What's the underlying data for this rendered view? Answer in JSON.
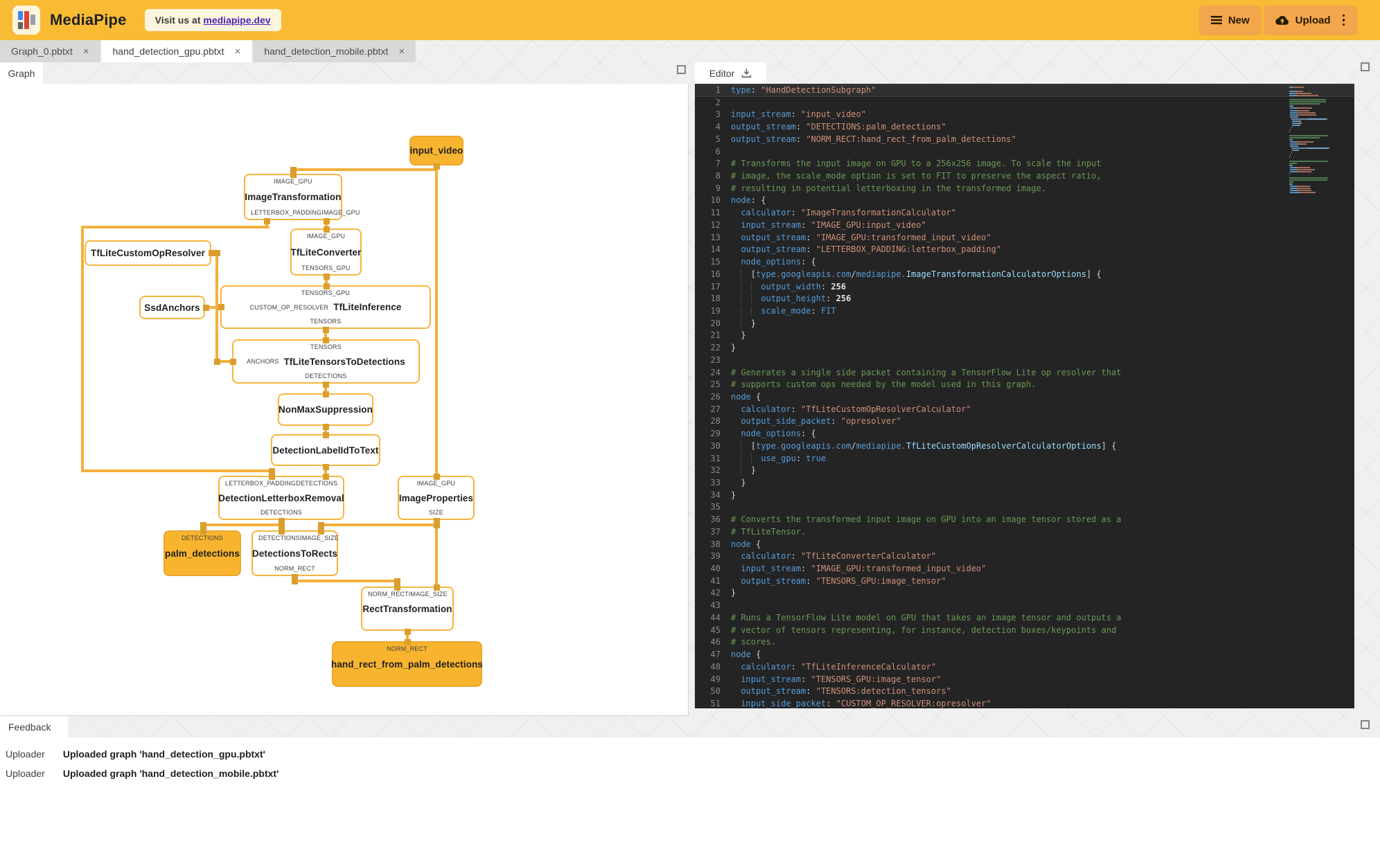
{
  "header": {
    "app_title": "MediaPipe",
    "visit_prefix": "Visit us at ",
    "visit_link": "mediapipe.dev",
    "new_label": "New",
    "upload_label": "Upload"
  },
  "tabs": [
    {
      "label": "Graph_0.pbtxt",
      "active": false
    },
    {
      "label": "hand_detection_gpu.pbtxt",
      "active": true
    },
    {
      "label": "hand_detection_mobile.pbtxt",
      "active": false
    }
  ],
  "graph_panel": {
    "tab_label": "Graph",
    "nodes": [
      {
        "id": "input_video",
        "label": "input_video",
        "kind": "stream",
        "ports": {}
      },
      {
        "id": "ImageTransformation",
        "label": "ImageTransformation",
        "kind": "calc",
        "ports": {
          "top": [
            "IMAGE_GPU"
          ],
          "bottom": [
            "LETTERBOX_PADDING",
            "IMAGE_GPU"
          ]
        }
      },
      {
        "id": "TfLiteCustomOpResolver",
        "label": "TfLiteCustomOpResolver",
        "kind": "calc",
        "ports": {}
      },
      {
        "id": "TfLiteConverter",
        "label": "TfLiteConverter",
        "kind": "calc",
        "ports": {
          "top": [
            "IMAGE_GPU"
          ],
          "bottom": [
            "TENSORS_GPU"
          ]
        }
      },
      {
        "id": "SsdAnchors",
        "label": "SsdAnchors",
        "kind": "calc",
        "ports": {}
      },
      {
        "id": "TfLiteInference",
        "label": "TfLiteInference",
        "kind": "calc",
        "ports": {
          "top": [
            "TENSORS_GPU"
          ],
          "left": "CUSTOM_OP_RESOLVER",
          "bottom": [
            "TENSORS"
          ]
        }
      },
      {
        "id": "TfLiteTensorsToDetections",
        "label": "TfLiteTensorsToDetections",
        "kind": "calc",
        "ports": {
          "top": [
            "TENSORS"
          ],
          "left": "ANCHORS",
          "bottom": [
            "DETECTIONS"
          ]
        }
      },
      {
        "id": "NonMaxSuppression",
        "label": "NonMaxSuppression",
        "kind": "calc",
        "ports": {}
      },
      {
        "id": "DetectionLabelIdToText",
        "label": "DetectionLabelIdToText",
        "kind": "calc",
        "ports": {}
      },
      {
        "id": "DetectionLetterboxRemoval",
        "label": "DetectionLetterboxRemoval",
        "kind": "calc",
        "ports": {
          "top": [
            "LETTERBOX_PADDING",
            "DETECTIONS"
          ],
          "bottom": [
            "DETECTIONS"
          ]
        }
      },
      {
        "id": "ImageProperties",
        "label": "ImageProperties",
        "kind": "calc",
        "ports": {
          "top": [
            "IMAGE_GPU"
          ],
          "bottom": [
            "SIZE"
          ]
        }
      },
      {
        "id": "palm_detections",
        "label": "palm_detections",
        "kind": "stream",
        "ports": {
          "top": [
            "DETECTIONS"
          ]
        }
      },
      {
        "id": "DetectionsToRects",
        "label": "DetectionsToRects",
        "kind": "calc",
        "ports": {
          "top": [
            "DETECTIONS",
            "IMAGE_SIZE"
          ],
          "bottom": [
            "NORM_RECT"
          ]
        }
      },
      {
        "id": "RectTransformation",
        "label": "RectTransformation",
        "kind": "calc",
        "ports": {
          "top": [
            "NORM_RECT",
            "IMAGE_SIZE"
          ]
        }
      },
      {
        "id": "hand_rect_from_palm_detections",
        "label": "hand_rect_from_palm_detections",
        "kind": "stream",
        "ports": {
          "top": [
            "NORM_RECT"
          ]
        }
      }
    ]
  },
  "editor": {
    "tab_label": "Editor",
    "lines": [
      "type: \"HandDetectionSubgraph\"",
      "",
      "input_stream: \"input_video\"",
      "output_stream: \"DETECTIONS:palm_detections\"",
      "output_stream: \"NORM_RECT:hand_rect_from_palm_detections\"",
      "",
      "# Transforms the input image on GPU to a 256x256 image. To scale the input",
      "# image, the scale_mode option is set to FIT to preserve the aspect ratio,",
      "# resulting in potential letterboxing in the transformed image.",
      "node: {",
      "  calculator: \"ImageTransformationCalculator\"",
      "  input_stream: \"IMAGE_GPU:input_video\"",
      "  output_stream: \"IMAGE_GPU:transformed_input_video\"",
      "  output_stream: \"LETTERBOX_PADDING:letterbox_padding\"",
      "  node_options: {",
      "    [type.googleapis.com/mediapipe.ImageTransformationCalculatorOptions] {",
      "      output_width: 256",
      "      output_height: 256",
      "      scale_mode: FIT",
      "    }",
      "  }",
      "}",
      "",
      "# Generates a single side packet containing a TensorFlow Lite op resolver that",
      "# supports custom ops needed by the model used in this graph.",
      "node {",
      "  calculator: \"TfLiteCustomOpResolverCalculator\"",
      "  output_side_packet: \"opresolver\"",
      "  node_options: {",
      "    [type.googleapis.com/mediapipe.TfLiteCustomOpResolverCalculatorOptions] {",
      "      use_gpu: true",
      "    }",
      "  }",
      "}",
      "",
      "# Converts the transformed input image on GPU into an image tensor stored as a",
      "# TfLiteTensor.",
      "node {",
      "  calculator: \"TfLiteConverterCalculator\"",
      "  input_stream: \"IMAGE_GPU:transformed_input_video\"",
      "  output_stream: \"TENSORS_GPU:image_tensor\"",
      "}",
      "",
      "# Runs a TensorFlow Lite model on GPU that takes an image tensor and outputs a",
      "# vector of tensors representing, for instance, detection boxes/keypoints and",
      "# scores.",
      "node {",
      "  calculator: \"TfLiteInferenceCalculator\"",
      "  input_stream: \"TENSORS_GPU:image_tensor\"",
      "  output_stream: \"TENSORS:detection_tensors\"",
      "  input_side_packet: \"CUSTOM_OP_RESOLVER:opresolver\""
    ]
  },
  "feedback": {
    "tab_label": "Feedback",
    "entries": [
      {
        "source": "Uploader",
        "message": "Uploaded graph 'hand_detection_gpu.pbtxt'"
      },
      {
        "source": "Uploader",
        "message": "Uploaded graph 'hand_detection_mobile.pbtxt'"
      }
    ]
  },
  "colors": {
    "header_bg": "#F9BB33",
    "header_button_bg": "#F3A64C",
    "link_purple": "#4B24B8",
    "node_border": "#F6B53E",
    "edge": "#F3B03C",
    "joint": "#DB9E2D",
    "stream_node_bg": "#F8B42F",
    "editor_bg": "#242425",
    "syntax_key": "#569CD6",
    "syntax_string": "#CE9178",
    "syntax_comment": "#6A9955",
    "syntax_option": "#9CDCFE",
    "syntax_dot": "#D16969"
  }
}
